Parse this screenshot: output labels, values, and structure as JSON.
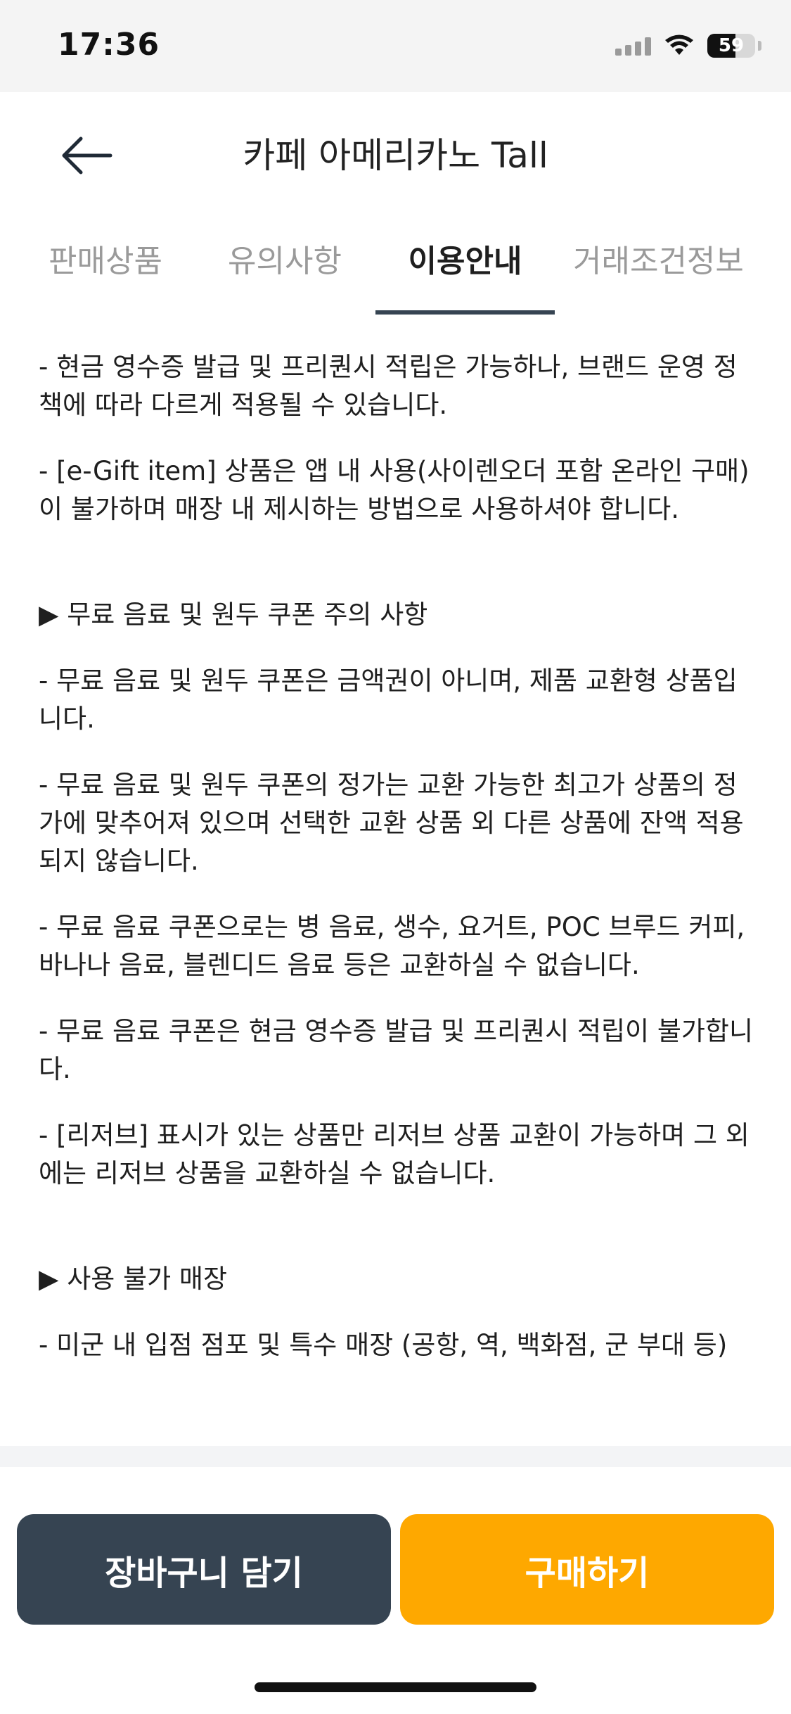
{
  "status": {
    "time": "17:36",
    "battery": "59",
    "battery_level_percent": 59
  },
  "header": {
    "title": "카페 아메리카노 Tall",
    "back_icon": "arrow-left-icon"
  },
  "tabs": [
    {
      "label": "판매상품",
      "active": false
    },
    {
      "label": "유의사항",
      "active": false
    },
    {
      "label": "이용안내",
      "active": true
    },
    {
      "label": "거래조건정보",
      "active": false
    }
  ],
  "content": {
    "p1": "- 현금 영수증 발급 및 프리퀀시 적립은 가능하나, 브랜드 운영 정책에 따라 다르게 적용될 수 있습니다.",
    "p2": "- [e-Gift item] 상품은 앱 내 사용(사이렌오더 포함 온라인 구매)이 불가하며 매장 내 제시하는 방법으로 사용하셔야 합니다.",
    "section1": "▶ 무료 음료 및 원두 쿠폰 주의 사항",
    "s1p1": "- 무료 음료 및 원두 쿠폰은 금액권이 아니며, 제품 교환형 상품입니다.",
    "s1p2": "- 무료 음료 및 원두 쿠폰의 정가는 교환 가능한 최고가 상품의 정가에 맞추어져 있으며 선택한 교환 상품 외 다른 상품에 잔액 적용되지 않습니다.",
    "s1p3": "- 무료 음료 쿠폰으로는 병 음료, 생수, 요거트, POC 브루드 커피, 바나나 음료, 블렌디드 음료 등은 교환하실 수 없습니다.",
    "s1p4": "- 무료 음료 쿠폰은 현금 영수증 발급 및 프리퀀시 적립이 불가합니다.",
    "s1p5": "- [리저브] 표시가 있는 상품만 리저브 상품 교환이 가능하며 그 외에는 리저브 상품을 교환하실 수 없습니다.",
    "section2": "▶ 사용 불가 매장",
    "s2p1": "- 미군 내 입점 점포 및 특수 매장 (공항, 역, 백화점, 군 부대 등)"
  },
  "buttons": {
    "cart": "장바구니 담기",
    "buy": "구매하기"
  },
  "colors": {
    "primary_dark": "#364452",
    "accent_orange": "#fea800",
    "inactive_tab": "#9a9a9a"
  }
}
